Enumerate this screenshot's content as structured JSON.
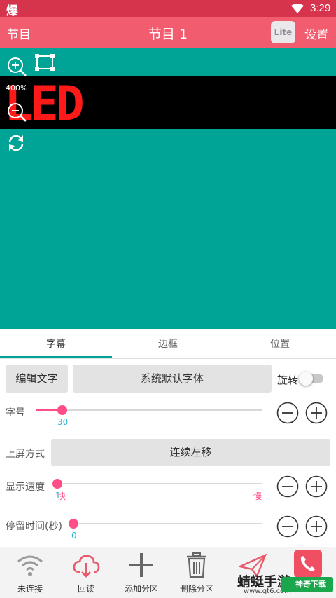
{
  "status_bar": {
    "app_glyph": "爆",
    "time": "3:29"
  },
  "app_bar": {
    "left_label": "节目",
    "title": "节目 1",
    "lite_badge": "Lite",
    "settings_label": "设置"
  },
  "canvas": {
    "zoom_label": "400%",
    "led_text": "LED",
    "led_color": "#ff1a1a",
    "background": "#00a496"
  },
  "tabs": [
    {
      "label": "字幕",
      "active": true
    },
    {
      "label": "边框",
      "active": false
    },
    {
      "label": "位置",
      "active": false
    }
  ],
  "controls": {
    "edit_text_button": "编辑文字",
    "font_button": "系统默认字体",
    "rotate_label": "旋转",
    "rotate_on": false,
    "font_size": {
      "label": "字号",
      "value": "30",
      "fraction": 0.16
    },
    "scroll_mode": {
      "label": "上屏方式",
      "value": "连续左移"
    },
    "speed": {
      "label": "显示速度",
      "value": "1",
      "fraction": 0.0,
      "fast_label": "快",
      "slow_label": "慢"
    },
    "dwell_time": {
      "label": "停留时间(秒)",
      "value": "0",
      "fraction": 0.0
    }
  },
  "bottom_bar": [
    {
      "label": "未连接",
      "icon": "wifi-icon"
    },
    {
      "label": "回读",
      "icon": "cloud-download-icon"
    },
    {
      "label": "添加分区",
      "icon": "plus-icon"
    },
    {
      "label": "删除分区",
      "icon": "trash-icon"
    },
    {
      "label": "",
      "icon": "send-icon"
    },
    {
      "label": "",
      "icon": "phone-icon"
    }
  ],
  "watermark": {
    "main": "蜻蜓手游",
    "sub": "www.qt6.com",
    "brand": "神奇下载"
  },
  "colors": {
    "status_bar": "#d6334c",
    "app_bar": "#f15c6f",
    "accent": "#ff4d85",
    "teal": "#00a496",
    "value_cyan": "#29b6d6"
  }
}
